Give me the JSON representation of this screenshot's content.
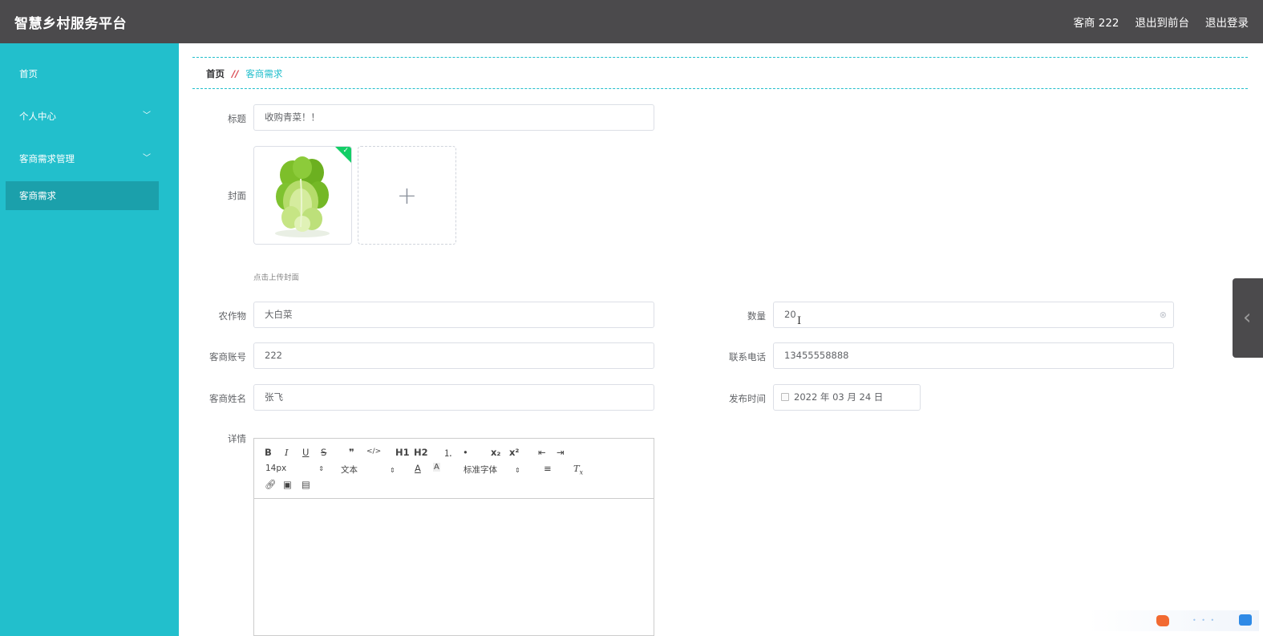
{
  "header": {
    "brand": "智慧乡村服务平台",
    "user": "客商 222",
    "to_frontend": "退出到前台",
    "logout": "退出登录"
  },
  "sidebar": {
    "items": [
      {
        "label": "首页"
      },
      {
        "label": "个人中心"
      },
      {
        "label": "客商需求管理"
      },
      {
        "label": "客商需求"
      }
    ]
  },
  "breadcrumb": {
    "home": "首页",
    "separator": "//",
    "current": "客商需求"
  },
  "form": {
    "title_label": "标题",
    "title_value": "收购青菜！！",
    "cover_label": "封面",
    "cover_hint": "点击上传封面",
    "crop_label": "农作物",
    "crop_value": "大白菜",
    "qty_label": "数量",
    "qty_value": "20",
    "account_label": "客商账号",
    "account_value": "222",
    "phone_label": "联系电话",
    "phone_value": "13455558888",
    "name_label": "客商姓名",
    "name_value": "张飞",
    "time_label": "发布时间",
    "time_value": "2022 年 03 月 24 日",
    "detail_label": "详情"
  },
  "editor": {
    "row1": [
      "B",
      "I",
      "U",
      "S",
      "❞",
      "</>",
      "H1",
      "H2",
      "⒈",
      "•",
      "x₂",
      "x²",
      "⇤",
      "⇥"
    ],
    "font_size": "14px",
    "header_select": "文本",
    "font_family": "标准字体",
    "colors": {
      "accent": "#22bfcc",
      "header": "#4b4a4c",
      "active": "#1ba0ab",
      "success": "#13ce66",
      "separator": "#d9434c"
    }
  }
}
